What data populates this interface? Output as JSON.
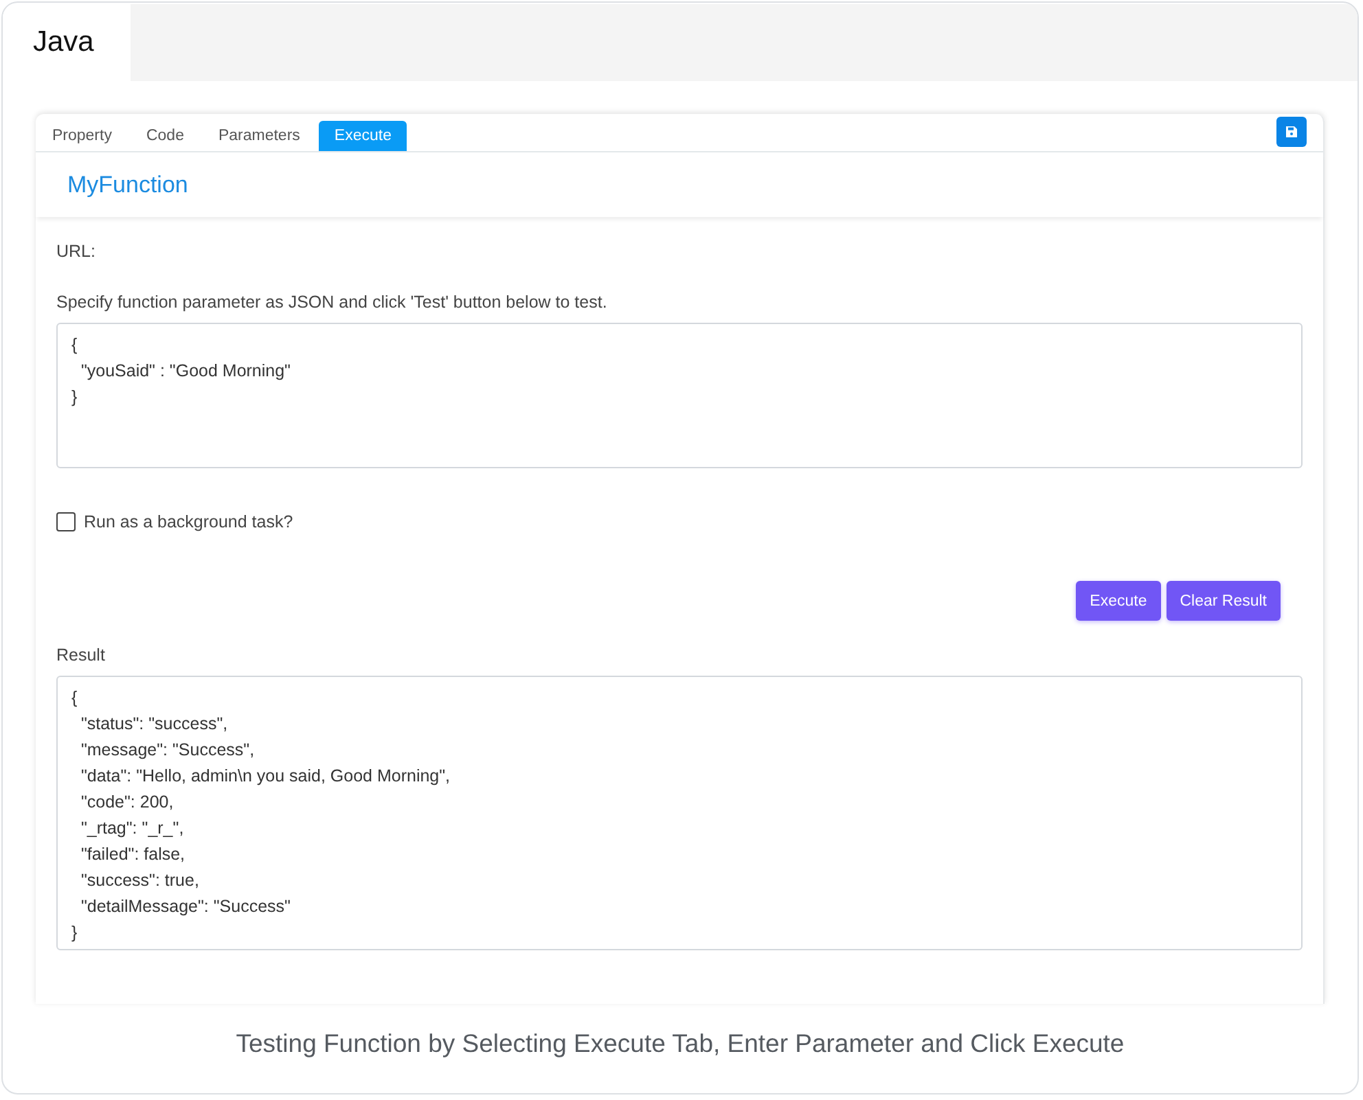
{
  "top_tab": {
    "label": "Java"
  },
  "tabs": [
    {
      "label": "Property",
      "selected": false
    },
    {
      "label": "Code",
      "selected": false
    },
    {
      "label": "Parameters",
      "selected": false
    },
    {
      "label": "Execute",
      "selected": true
    }
  ],
  "function_title": "MyFunction",
  "url_label": "URL:",
  "instructions": "Specify function parameter as JSON and click 'Test' button below to test.",
  "parameter_input": {
    "value": "{\n  \"youSaid\" : \"Good Morning\"\n}"
  },
  "background_task": {
    "label": "Run as a background task?",
    "checked": false
  },
  "buttons": [
    "Execute",
    "Clear Result"
  ],
  "result_label": "Result",
  "result": {
    "value": "{\n  \"status\": \"success\",\n  \"message\": \"Success\",\n  \"data\": \"Hello, admin\\n you said, Good Morning\",\n  \"code\": 200,\n  \"_rtag\": \"_r_\",\n  \"failed\": false,\n  \"success\": true,\n  \"detailMessage\": \"Success\"\n}"
  },
  "caption": "Testing Function by Selecting Execute Tab, Enter Parameter and Click Execute"
}
